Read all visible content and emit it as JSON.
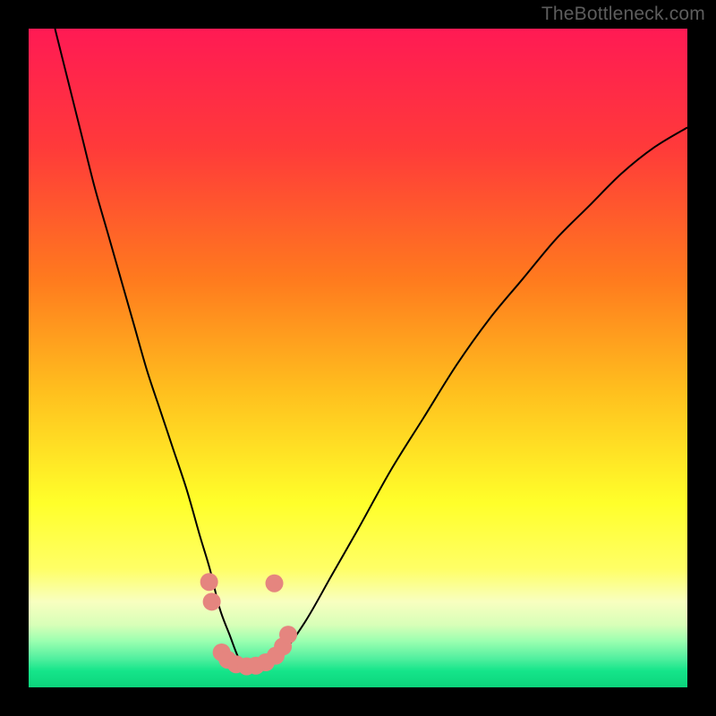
{
  "watermark": "TheBottleneck.com",
  "chart_data": {
    "type": "line",
    "title": "",
    "xlabel": "",
    "ylabel": "",
    "xlim": [
      0,
      100
    ],
    "ylim": [
      0,
      100
    ],
    "grid": false,
    "legend": false,
    "background": {
      "type": "vertical-gradient",
      "stops": [
        {
          "pos": 0.0,
          "color": "#ff1a54"
        },
        {
          "pos": 0.18,
          "color": "#ff3a3a"
        },
        {
          "pos": 0.38,
          "color": "#ff7a1e"
        },
        {
          "pos": 0.55,
          "color": "#ffbf1e"
        },
        {
          "pos": 0.72,
          "color": "#ffff2a"
        },
        {
          "pos": 0.82,
          "color": "#ffff66"
        },
        {
          "pos": 0.87,
          "color": "#f8ffc0"
        },
        {
          "pos": 0.905,
          "color": "#d8ffb8"
        },
        {
          "pos": 0.93,
          "color": "#9affb0"
        },
        {
          "pos": 0.955,
          "color": "#55f0a0"
        },
        {
          "pos": 0.975,
          "color": "#15e58a"
        },
        {
          "pos": 1.0,
          "color": "#0cd47c"
        }
      ]
    },
    "series": [
      {
        "name": "bottleneck-curve",
        "color": "#000000",
        "stroke_width": 2,
        "x": [
          4,
          6,
          8,
          10,
          12,
          14,
          16,
          18,
          20,
          22,
          24,
          26,
          27.5,
          29,
          30.5,
          32,
          33.5,
          35,
          38,
          42,
          46,
          50,
          55,
          60,
          65,
          70,
          75,
          80,
          85,
          90,
          95,
          100
        ],
        "y": [
          100,
          92,
          84,
          76,
          69,
          62,
          55,
          48,
          42,
          36,
          30,
          23,
          18,
          12,
          8,
          4.2,
          2.5,
          2.5,
          4.5,
          10,
          17,
          24,
          33,
          41,
          49,
          56,
          62,
          68,
          73,
          78,
          82,
          85
        ]
      }
    ],
    "markers": {
      "name": "highlight-dots",
      "color": "#e5857f",
      "radius": 10,
      "points": [
        {
          "x": 27.4,
          "y": 16.0
        },
        {
          "x": 27.8,
          "y": 13.0
        },
        {
          "x": 29.3,
          "y": 5.3
        },
        {
          "x": 30.2,
          "y": 4.2
        },
        {
          "x": 31.5,
          "y": 3.5
        },
        {
          "x": 33.1,
          "y": 3.2
        },
        {
          "x": 34.5,
          "y": 3.3
        },
        {
          "x": 36.0,
          "y": 3.8
        },
        {
          "x": 37.5,
          "y": 4.8
        },
        {
          "x": 38.6,
          "y": 6.2
        },
        {
          "x": 39.4,
          "y": 8.0
        },
        {
          "x": 37.3,
          "y": 15.8
        }
      ]
    }
  }
}
